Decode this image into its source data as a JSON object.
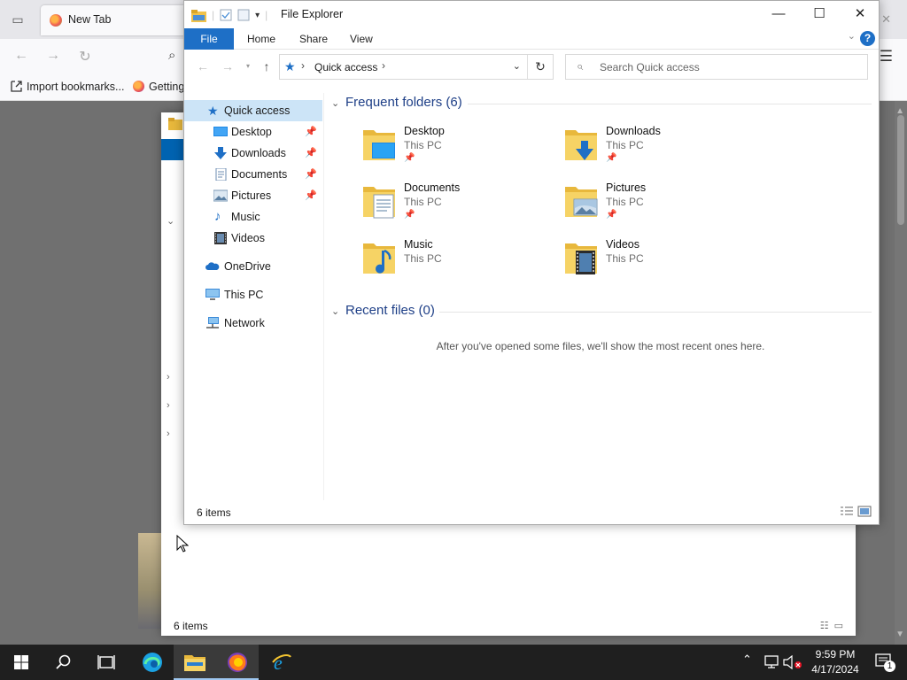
{
  "browser": {
    "tab_label": "New Tab",
    "bookmarks": {
      "import": "Import bookmarks...",
      "getting": "Getting"
    }
  },
  "explorer": {
    "title": "File Explorer",
    "ribbon_tabs": {
      "file": "File",
      "home": "Home",
      "share": "Share",
      "view": "View"
    },
    "address": {
      "crumb": "Quick access"
    },
    "search": {
      "placeholder": "Search Quick access"
    },
    "nav": {
      "quick_access": "Quick access",
      "desktop": "Desktop",
      "downloads": "Downloads",
      "documents": "Documents",
      "pictures": "Pictures",
      "music": "Music",
      "videos": "Videos",
      "onedrive": "OneDrive",
      "this_pc": "This PC",
      "network": "Network"
    },
    "frequent": {
      "header": "Frequent folders (6)",
      "items": [
        {
          "name": "Desktop",
          "location": "This PC"
        },
        {
          "name": "Downloads",
          "location": "This PC"
        },
        {
          "name": "Documents",
          "location": "This PC"
        },
        {
          "name": "Pictures",
          "location": "This PC"
        },
        {
          "name": "Music",
          "location": "This PC"
        },
        {
          "name": "Videos",
          "location": "This PC"
        }
      ]
    },
    "recent": {
      "header": "Recent files (0)",
      "empty_message": "After you've opened some files, we'll show the most recent ones here."
    },
    "status": {
      "count": "6 items"
    }
  },
  "back_window": {
    "status": "6 items"
  },
  "taskbar": {
    "time": "9:59 PM",
    "date": "4/17/2024",
    "notification_count": "1"
  },
  "colors": {
    "accent": "#1e6fc6",
    "selection": "#cce4f7",
    "group_header": "#1e3f87",
    "taskbar": "#1f1f1f"
  }
}
